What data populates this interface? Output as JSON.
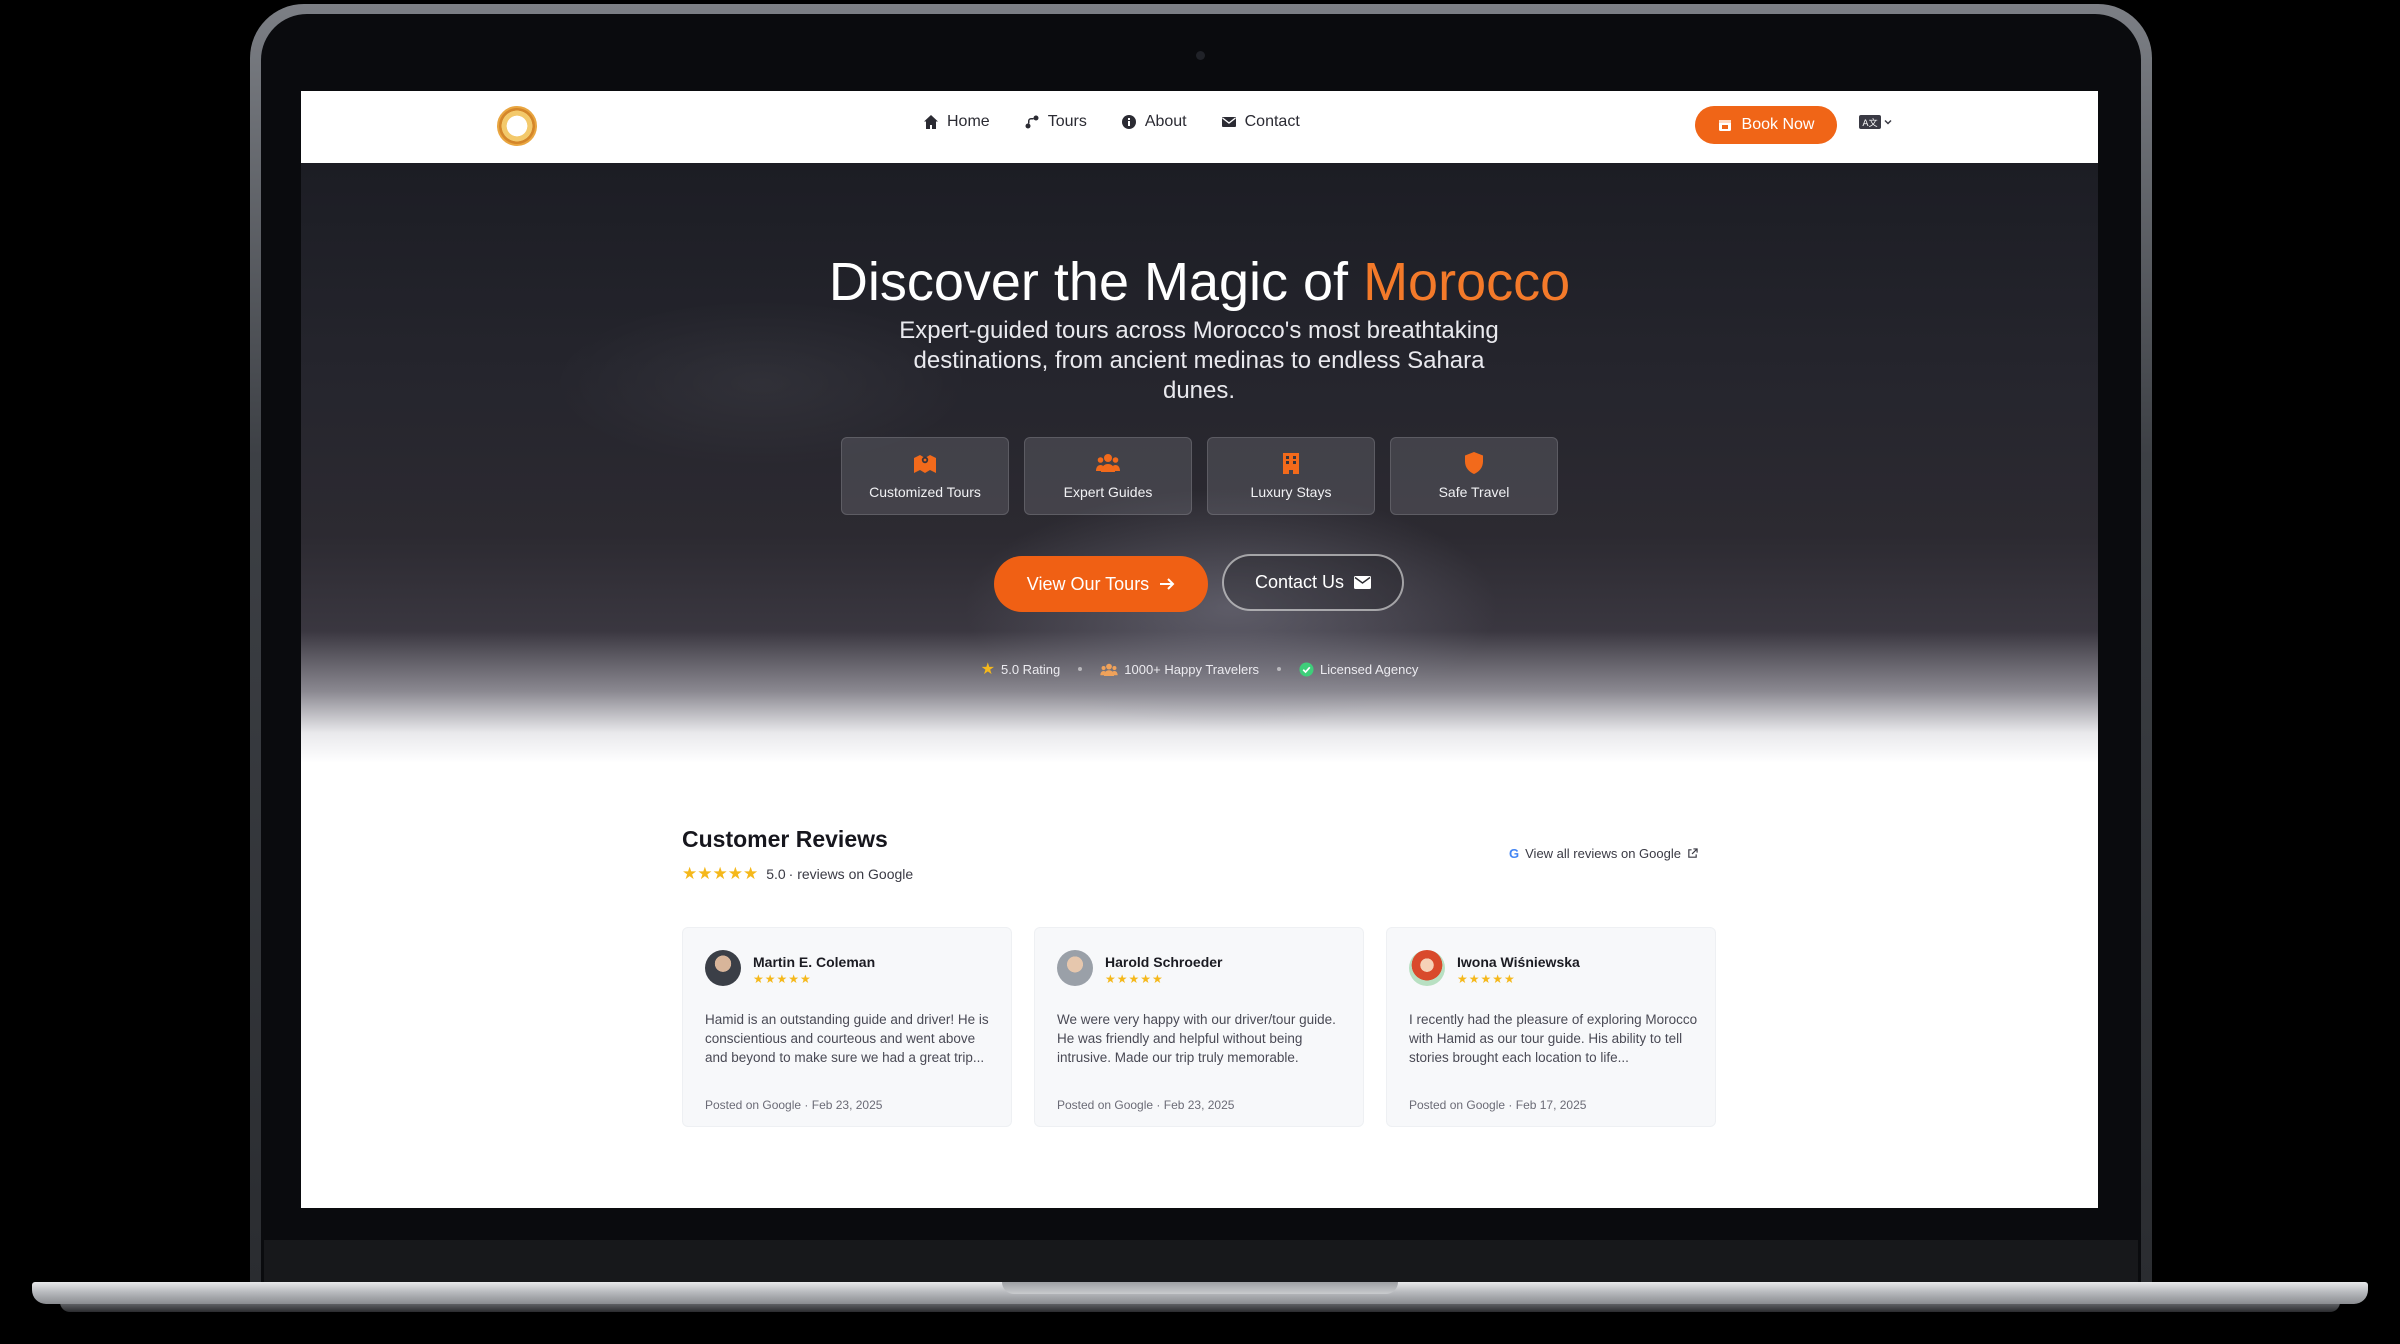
{
  "nav": {
    "home": "Home",
    "tours": "Tours",
    "about": "About",
    "contact": "Contact",
    "book_now": "Book Now",
    "language_label": "A文"
  },
  "hero": {
    "title_prefix": "Discover the Magic of",
    "title_accent": "Morocco",
    "subtitle": "Expert-guided tours across Morocco's most breathtaking destinations, from ancient medinas to endless Sahara dunes.",
    "features": [
      {
        "icon": "map-icon",
        "label": "Customized Tours"
      },
      {
        "icon": "users-icon",
        "label": "Expert Guides"
      },
      {
        "icon": "hotel-icon",
        "label": "Luxury Stays"
      },
      {
        "icon": "shield-icon",
        "label": "Safe Travel"
      }
    ],
    "cta_primary": "View Our Tours",
    "cta_secondary": "Contact Us",
    "stats": {
      "rating": "5.0 Rating",
      "travelers": "1000+ Happy Travelers",
      "licensed": "Licensed Agency"
    }
  },
  "reviews": {
    "title": "Customer Reviews",
    "rating_value": "5.0",
    "rating_source": "· reviews on Google",
    "view_all": "View all reviews on Google",
    "items": [
      {
        "name": "Martin E. Coleman",
        "stars": "★★★★★",
        "text": "Hamid is an outstanding guide and driver! He is conscientious and courteous and went above and beyond to make sure we had a great trip...",
        "meta": "Posted on Google · Feb 23, 2025"
      },
      {
        "name": "Harold Schroeder",
        "stars": "★★★★★",
        "text": "We were very happy with our driver/tour guide. He was friendly and helpful without being intrusive. Made our trip truly memorable.",
        "meta": "Posted on Google · Feb 23, 2025"
      },
      {
        "name": "Iwona Wiśniewska",
        "stars": "★★★★★",
        "text": "I recently had the pleasure of exploring Morocco with Hamid as our tour guide. His ability to tell stories brought each location to life...",
        "meta": "Posted on Google · Feb 17, 2025"
      }
    ]
  },
  "colors": {
    "accent": "#f06517",
    "star": "#f5b81b",
    "dark": "#16161d"
  }
}
